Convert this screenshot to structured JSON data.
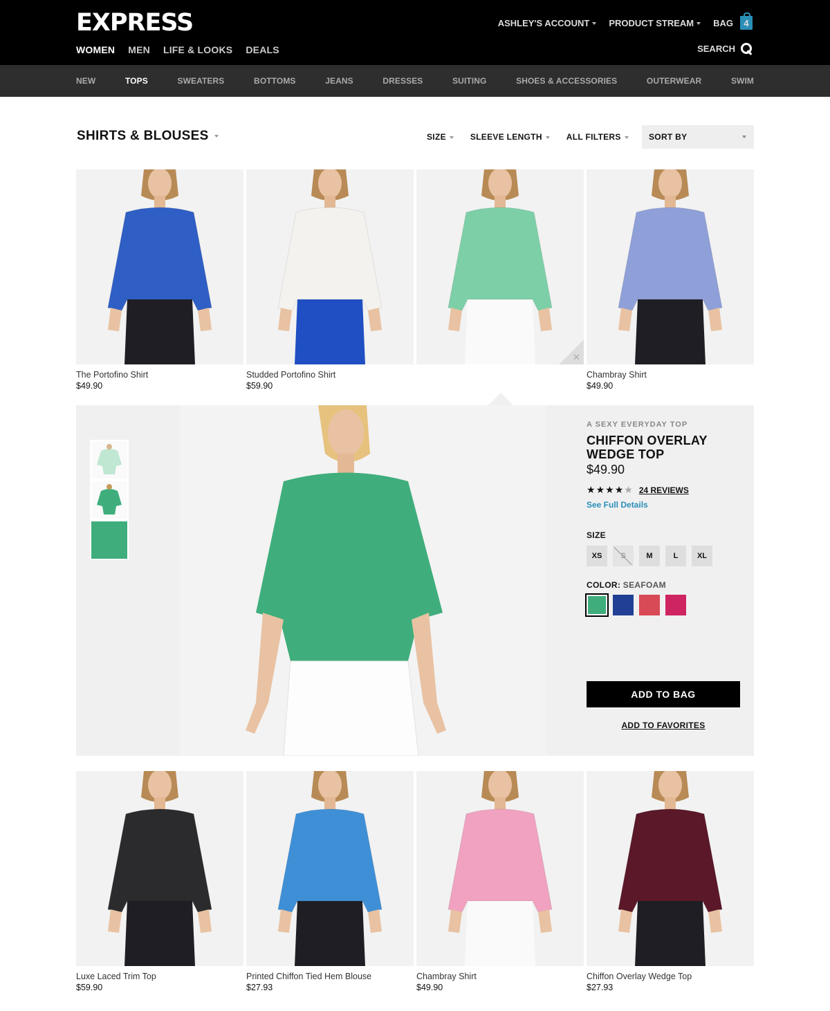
{
  "header": {
    "logo": "EXPRESS",
    "main_nav": [
      "WOMEN",
      "MEN",
      "LIFE & LOOKS",
      "DEALS"
    ],
    "account_label": "ASHLEY'S ACCOUNT",
    "product_stream_label": "PRODUCT STREAM",
    "bag_label": "BAG",
    "bag_count": "4",
    "search_label": "SEARCH"
  },
  "subnav": [
    "NEW",
    "TOPS",
    "SWEATERS",
    "BOTTOMS",
    "JEANS",
    "DRESSES",
    "SUITING",
    "SHOES & ACCESSORIES",
    "OUTERWEAR",
    "SWIM"
  ],
  "page": {
    "title": "SHIRTS & BLOUSES",
    "filters": [
      "SIZE",
      "SLEEVE LENGTH",
      "ALL FILTERS"
    ],
    "sort_label": "SORT BY"
  },
  "products_top": [
    {
      "name": "The Portofino Shirt",
      "price": "$49.90",
      "color": "#2f5fc4"
    },
    {
      "name": "Studded Portofino Shirt",
      "price": "$59.90",
      "color": "#f4f2ee"
    },
    {
      "name": "",
      "price": "",
      "color": "#7dcfa7"
    },
    {
      "name": "Chambray Shirt",
      "price": "$49.90",
      "color": "#8f9fd8"
    }
  ],
  "products_bottom": [
    {
      "name": "Luxe Laced Trim Top",
      "price": "$59.90",
      "color": "#2b2b2d"
    },
    {
      "name": "Printed Chiffon Tied Hem Blouse",
      "price": "$27.93",
      "color": "#3f8fd6"
    },
    {
      "name": "Chambray Shirt",
      "price": "$49.90",
      "color": "#f0a2c0"
    },
    {
      "name": "Chiffon Overlay Wedge Top",
      "price": "$27.93",
      "color": "#5a1828"
    }
  ],
  "quick_view": {
    "tagline": "A SEXY EVERYDAY TOP",
    "title": "CHIFFON OVERLAY WEDGE TOP",
    "price": "$49.90",
    "rating": 4,
    "rating_max": 5,
    "reviews": "24 REVIEWS",
    "details_link": "See Full Details",
    "size_label": "SIZE",
    "sizes": [
      "XS",
      "S",
      "M",
      "L",
      "XL"
    ],
    "unavailable_size": "S",
    "color_label": "COLOR",
    "color_value": "SEAFOAM",
    "colors": [
      "#3fae7c",
      "#213f95",
      "#d84a56",
      "#cf2462"
    ],
    "add_to_bag": "ADD TO BAG",
    "add_to_favorites": "ADD TO FAVORITES"
  }
}
